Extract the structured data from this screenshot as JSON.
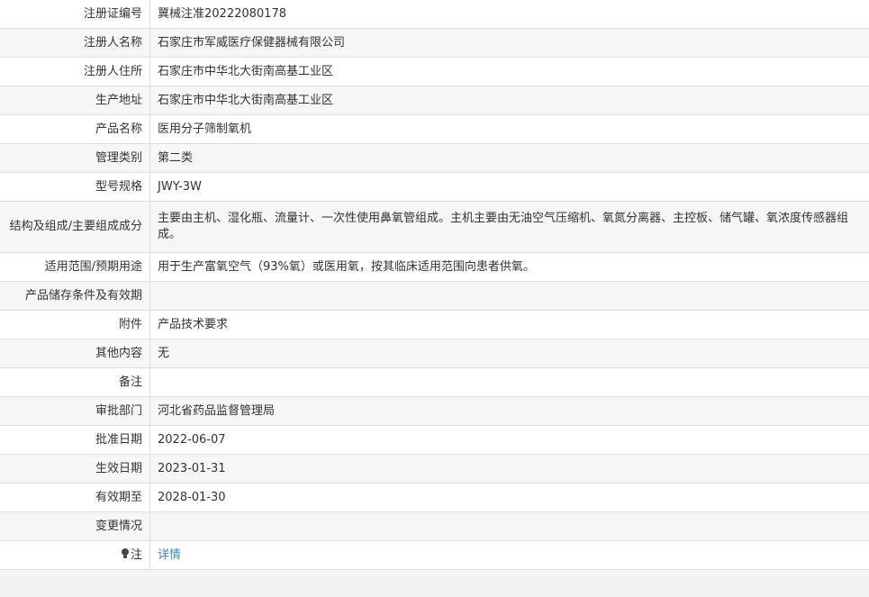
{
  "rows": [
    {
      "label": "注册证编号",
      "value": "冀械注准20222080178"
    },
    {
      "label": "注册人名称",
      "value": "石家庄市军威医疗保健器械有限公司"
    },
    {
      "label": "注册人住所",
      "value": "石家庄市中华北大街南高基工业区"
    },
    {
      "label": "生产地址",
      "value": "石家庄市中华北大街南高基工业区"
    },
    {
      "label": "产品名称",
      "value": "医用分子筛制氧机"
    },
    {
      "label": "管理类别",
      "value": "第二类"
    },
    {
      "label": "型号规格",
      "value": "JWY-3W"
    },
    {
      "label": "结构及组成/主要组成成分",
      "value": "主要由主机、湿化瓶、流量计、一次性使用鼻氧管组成。主机主要由无油空气压缩机、氧氮分离器、主控板、储气罐、氧浓度传感器组成。"
    },
    {
      "label": "适用范围/预期用途",
      "value": "用于生产富氧空气（93%氧）或医用氧，按其临床适用范围向患者供氧。"
    },
    {
      "label": "产品储存条件及有效期",
      "value": ""
    },
    {
      "label": "附件",
      "value": "产品技术要求"
    },
    {
      "label": "其他内容",
      "value": "无"
    },
    {
      "label": "备注",
      "value": ""
    },
    {
      "label": "审批部门",
      "value": "河北省药品监督管理局"
    },
    {
      "label": "批准日期",
      "value": "2022-06-07"
    },
    {
      "label": "生效日期",
      "value": "2023-01-31"
    },
    {
      "label": "有效期至",
      "value": "2028-01-30"
    },
    {
      "label": "变更情况",
      "value": ""
    },
    {
      "label": "注",
      "value": "详情"
    }
  ],
  "colors": {
    "link": "#3a87c8",
    "border": "#dcdcdc",
    "stripe": "#f6f6f6"
  }
}
